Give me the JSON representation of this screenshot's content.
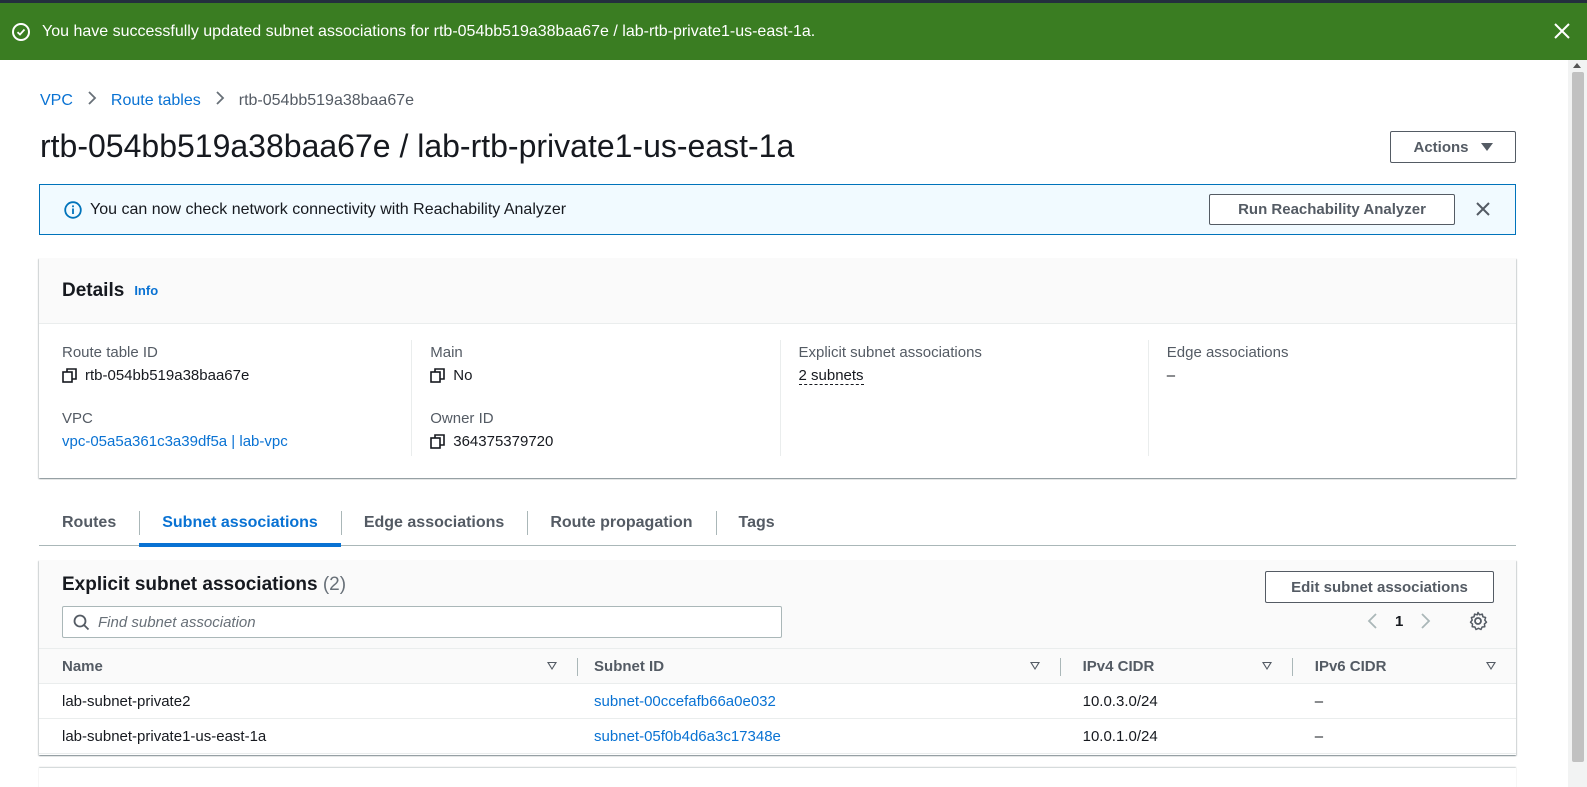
{
  "flash": {
    "message": "You have successfully updated subnet associations for rtb-054bb519a38baa67e / lab-rtb-private1-us-east-1a.",
    "status": "success",
    "color": "#3a7d22"
  },
  "breadcrumb": {
    "items": [
      "VPC",
      "Route tables"
    ],
    "current": "rtb-054bb519a38baa67e"
  },
  "page": {
    "title": "rtb-054bb519a38baa67e / lab-rtb-private1-us-east-1a",
    "actions_label": "Actions"
  },
  "alert": {
    "text": "You can now check network connectivity with Reachability Analyzer",
    "button_label": "Run Reachability Analyzer"
  },
  "details": {
    "heading": "Details",
    "info_label": "Info",
    "route_table_id_label": "Route table ID",
    "route_table_id": "rtb-054bb519a38baa67e",
    "vpc_label": "VPC",
    "vpc_value": "vpc-05a5a361c3a39df5a | lab-vpc",
    "main_label": "Main",
    "main_value": "No",
    "owner_label": "Owner ID",
    "owner_value": "364375379720",
    "explicit_label": "Explicit subnet associations",
    "explicit_value": "2 subnets",
    "edge_label": "Edge associations",
    "edge_value": "–"
  },
  "tabs": [
    "Routes",
    "Subnet associations",
    "Edge associations",
    "Route propagation",
    "Tags"
  ],
  "active_tab": "Subnet associations",
  "associations": {
    "heading": "Explicit subnet associations",
    "count": "(2)",
    "edit_label": "Edit subnet associations",
    "search_placeholder": "Find subnet association",
    "page_number": "1",
    "columns": [
      "Name",
      "Subnet ID",
      "IPv4 CIDR",
      "IPv6 CIDR"
    ],
    "rows": [
      {
        "name": "lab-subnet-private2",
        "subnet_id": "subnet-00ccefafb66a0e032",
        "ipv4": "10.0.3.0/24",
        "ipv6": "–"
      },
      {
        "name": "lab-subnet-private1-us-east-1a",
        "subnet_id": "subnet-05f0b4d6a3c17348e",
        "ipv4": "10.0.1.0/24",
        "ipv6": "–"
      }
    ]
  },
  "colors": {
    "link": "#0972d3",
    "info_border": "#0073bb",
    "info_bg": "#f1faff"
  }
}
